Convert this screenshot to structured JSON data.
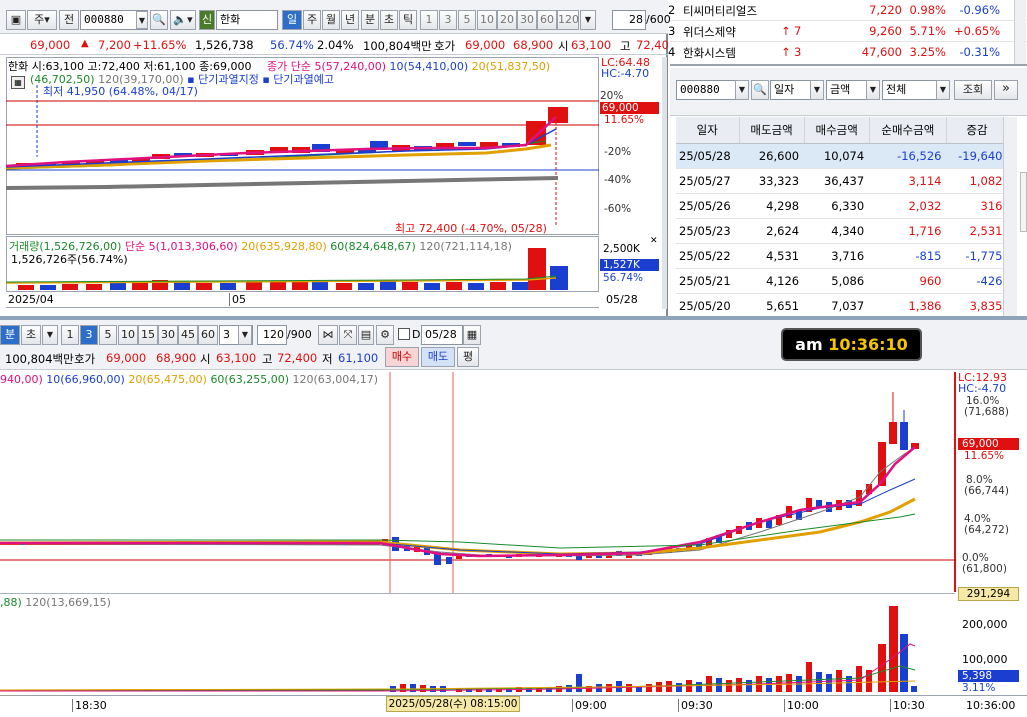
{
  "top": {
    "period_tabs": [
      "주",
      "전"
    ],
    "code": "000880",
    "badge": "신",
    "stock_name": "한화",
    "intervals": [
      "일",
      "주",
      "월",
      "년",
      "분",
      "초",
      "틱"
    ],
    "minute_buttons": [
      "1",
      "3",
      "5",
      "10",
      "20",
      "30",
      "60",
      "120"
    ],
    "count": "28",
    "count_total": "/600",
    "info": [
      "69,000",
      "▲",
      "7,200",
      "+11.65%",
      "1,526,738",
      "56.74%",
      "2.04%",
      "100,804백만",
      "호가",
      "69,000",
      "68,900",
      "시",
      "63,100",
      "고",
      "72,40"
    ]
  },
  "daily_chart": {
    "ohlc": "한화 시:63,100 고:72,400 저:61,100 종:69,000",
    "ma_legend": [
      "종가 단순 5(57,240,00)",
      "10(54,410,00)",
      "20(51,837,50)"
    ],
    "ma_legend2": [
      "(46,702,50)",
      "120(39,170,00)"
    ],
    "alerts": [
      "단기과열지정",
      "단기과열예고"
    ],
    "low_note": "최저 41,950 (64.48%, 04/17)",
    "high_note": "최고 72,400 (-4.70%, 05/28)",
    "lc": "LC:64.48",
    "hc": "HC:-4.70",
    "price_tag": "69,000",
    "pct_tag": "11.65%",
    "y_ticks": [
      "20%",
      "-20%",
      "-40%",
      "-60%"
    ],
    "vol_legend": [
      "거래량(1,526,726,00)",
      "단순 5(1,013,306,60)",
      "20(635,928,80)",
      "60(824,648,67)",
      "120(721,114,18)"
    ],
    "vol_note": "1,526,726주(56.74%)",
    "vol_ticks": [
      "2,500K"
    ],
    "vol_tag": "1,527K",
    "vol_pct": "56.74%",
    "x_ticks": [
      "2025/04",
      "05",
      "05/28"
    ]
  },
  "rank": [
    {
      "no": "2",
      "name": "티씨머티리얼즈",
      "arrow": "",
      "chg": "",
      "price": "7,220",
      "pct": "0.98%",
      "diff": "-0.96%"
    },
    {
      "no": "3",
      "name": "위더스제약",
      "arrow": "↑",
      "chg": "7",
      "price": "9,260",
      "pct": "5.71%",
      "diff": "+0.65%"
    },
    {
      "no": "4",
      "name": "한화시스템",
      "arrow": "↑",
      "chg": "3",
      "price": "47,600",
      "pct": "3.25%",
      "diff": "-0.31%"
    }
  ],
  "investor": {
    "code": "000880",
    "mode": "일자",
    "unit": "금액",
    "scope": "전체",
    "query": "조회",
    "headers": [
      "일자",
      "매도금액",
      "매수금액",
      "순매수금액",
      "증감"
    ],
    "rows": [
      [
        "25/05/28",
        "26,600",
        "10,074",
        "-16,526",
        "-19,640"
      ],
      [
        "25/05/27",
        "33,323",
        "36,437",
        "3,114",
        "1,082"
      ],
      [
        "25/05/26",
        "4,298",
        "6,330",
        "2,032",
        "316"
      ],
      [
        "25/05/23",
        "2,624",
        "4,340",
        "1,716",
        "2,531"
      ],
      [
        "25/05/22",
        "4,531",
        "3,716",
        "-815",
        "-1,775"
      ],
      [
        "25/05/21",
        "4,126",
        "5,086",
        "960",
        "-426"
      ],
      [
        "25/05/20",
        "5,651",
        "7,037",
        "1,386",
        "3,835"
      ]
    ]
  },
  "intraday": {
    "tabs": [
      "분",
      "초"
    ],
    "minutes": [
      "1",
      "3",
      "5",
      "10",
      "15",
      "30",
      "45",
      "60"
    ],
    "interval": "3",
    "count": "120",
    "count_total": "/900",
    "date": "05/28",
    "d_label": "D",
    "info": [
      "100,804백만",
      "호가",
      "69,000",
      "68,900",
      "시",
      "63,100",
      "고",
      "72,400",
      "저",
      "61,100"
    ],
    "buy": "매수",
    "sell": "매도",
    "even": "평",
    "clock_ampm": "am",
    "clock_time": "10:36:10",
    "ma_legend": [
      "940,00)",
      "10(66,960,00)",
      "20(65,475,00)",
      "60(63,255,00)",
      "120(63,004,17)"
    ],
    "vol_legend": [
      ",88)",
      "120(13,669,15)"
    ],
    "lc": "LC:12.93",
    "hc": "HC:-4.70",
    "right_ticks": [
      [
        "16.0%",
        "(71,688)"
      ],
      [
        "8.0%",
        "(66,744)"
      ],
      [
        "4.0%",
        "(64,272)"
      ],
      [
        "0.0%",
        "(61,800)"
      ]
    ],
    "price_tag": "69,000",
    "pct_tag": "11.65%",
    "vol_right_tag": "291,294",
    "vol_ticks": [
      "200,000",
      "100,000"
    ],
    "vol_tag": "5,398",
    "vol_pct": "3.11%",
    "crosshair_label": "2025/05/28(수) 08:15:00",
    "x_ticks": [
      "18:30",
      "09:00",
      "09:30",
      "10:00",
      "10:30",
      "10:36:00"
    ]
  }
}
